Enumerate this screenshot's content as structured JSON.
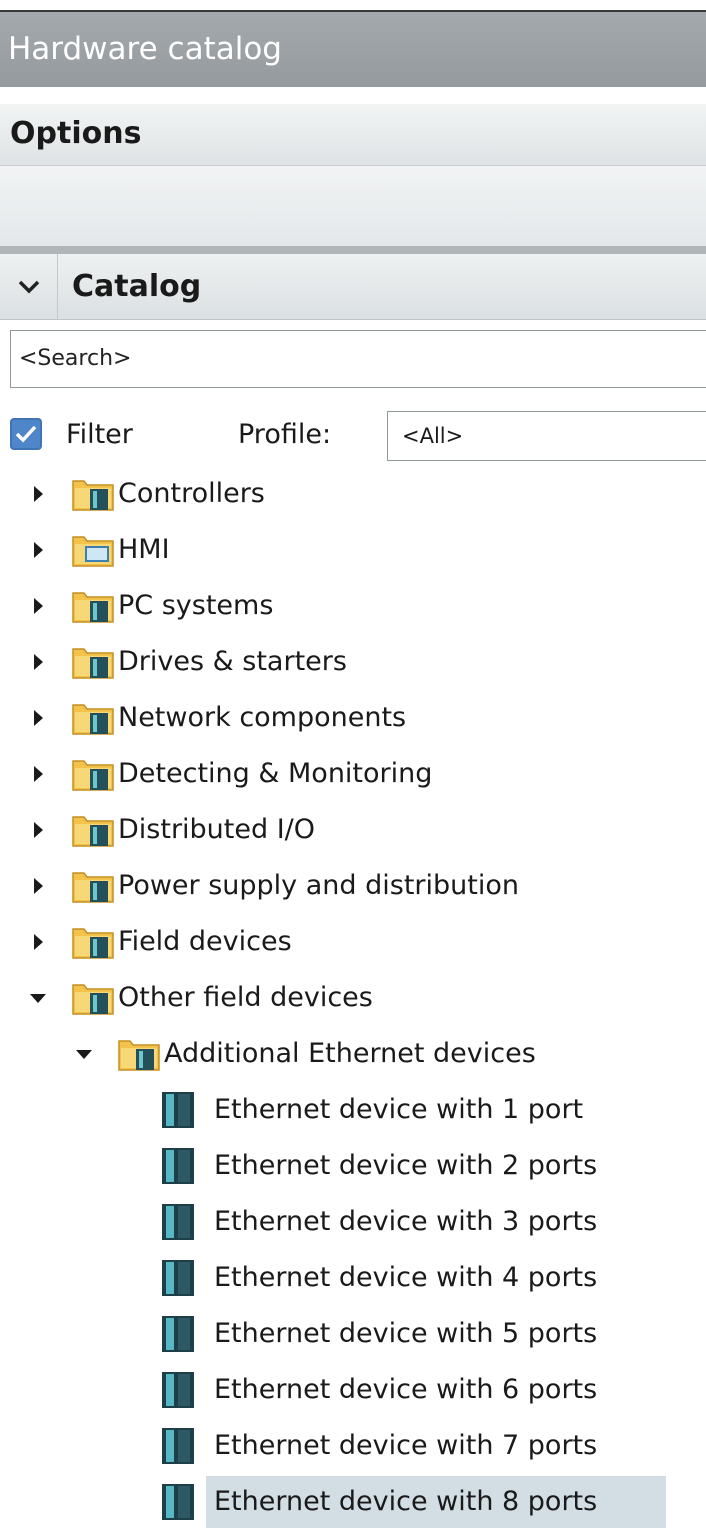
{
  "panel": {
    "title": "Hardware catalog"
  },
  "options": {
    "title": "Options"
  },
  "catalog": {
    "title": "Catalog",
    "search_placeholder": "<Search>",
    "filter_label": "Filter",
    "filter_checked": true,
    "profile_label": "Profile:",
    "profile_value": "<All>"
  },
  "tree": {
    "folders": [
      {
        "label": "Controllers",
        "icon": "device-folder-icon"
      },
      {
        "label": "HMI",
        "icon": "hmi-folder-icon"
      },
      {
        "label": "PC systems",
        "icon": "device-folder-icon"
      },
      {
        "label": "Drives & starters",
        "icon": "device-folder-icon"
      },
      {
        "label": "Network components",
        "icon": "device-folder-icon"
      },
      {
        "label": "Detecting & Monitoring",
        "icon": "device-folder-icon"
      },
      {
        "label": "Distributed I/O",
        "icon": "device-folder-icon"
      },
      {
        "label": "Power supply and distribution",
        "icon": "device-folder-icon"
      },
      {
        "label": "Field devices",
        "icon": "device-folder-icon"
      },
      {
        "label": "Other field devices",
        "icon": "device-folder-icon",
        "expanded": true
      }
    ],
    "subfolder": {
      "label": "Additional Ethernet devices",
      "icon": "device-folder-icon",
      "expanded": true
    },
    "devices": [
      {
        "label": "Ethernet device with 1 port"
      },
      {
        "label": "Ethernet device with 2 ports"
      },
      {
        "label": "Ethernet device with 3 ports"
      },
      {
        "label": "Ethernet device with 4 ports"
      },
      {
        "label": "Ethernet device with 5 ports"
      },
      {
        "label": "Ethernet device with 6 ports"
      },
      {
        "label": "Ethernet device with 7 ports"
      },
      {
        "label": "Ethernet device with 8 ports",
        "selected": true
      }
    ]
  },
  "colors": {
    "titlebar": "#9ea4a8",
    "selection": "#d2dde4",
    "checkbox": "#4e86c9",
    "folder": "#f3c24a",
    "device": "#24505a"
  }
}
